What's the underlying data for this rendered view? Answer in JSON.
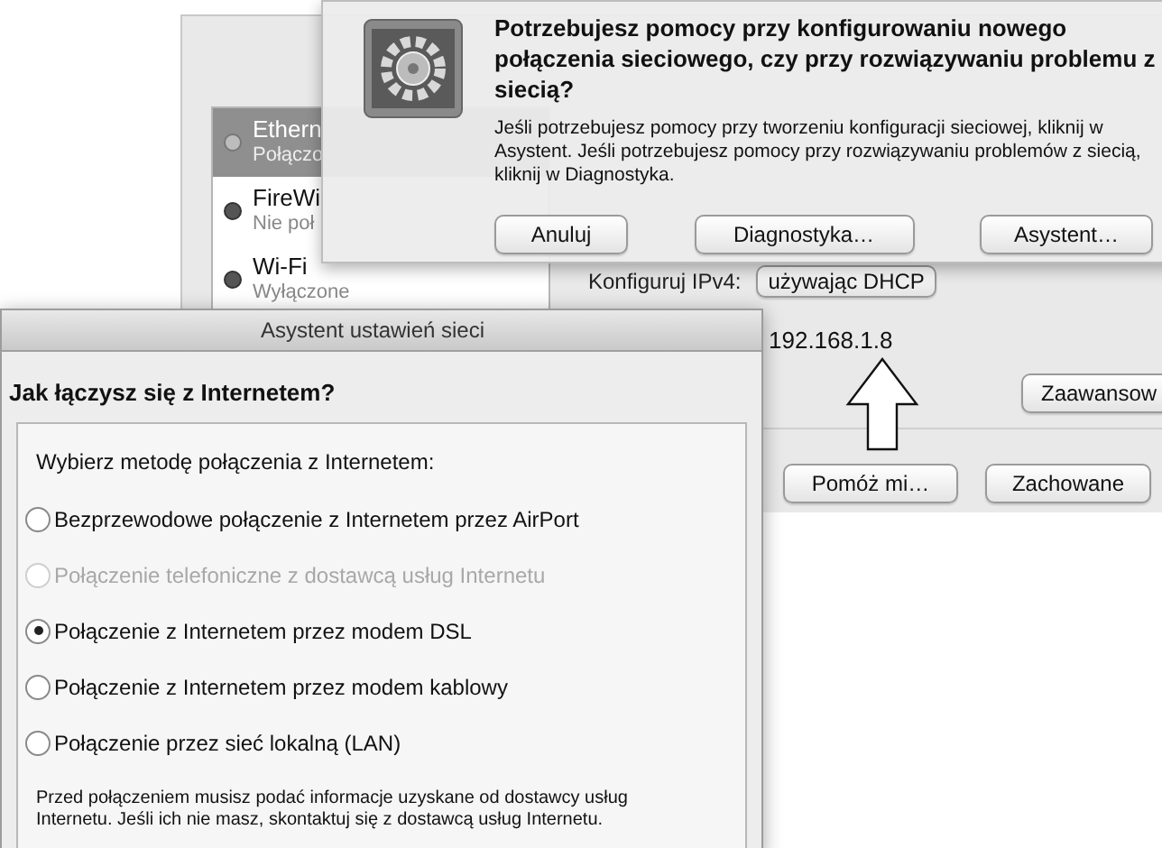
{
  "network_window": {
    "sidebar": [
      {
        "name": "Ethern",
        "status": "Połączo",
        "selected": true
      },
      {
        "name": "FireWi",
        "status": "Nie poł",
        "selected": false
      },
      {
        "name": "Wi-Fi",
        "status": "Wyłączone",
        "selected": false
      }
    ],
    "configure_label": "Konfiguruj IPv4:",
    "configure_value": "używając DHCP",
    "ip_address": "192.168.1.8",
    "advanced_button": "Zaawansow",
    "help_button": "Pomóż mi…",
    "saved_button": "Zachowane"
  },
  "sheet": {
    "title": "Potrzebujesz pomocy przy konfigurowaniu nowego połączenia sieciowego, czy przy rozwiązywaniu problemu z siecią?",
    "message": "Jeśli potrzebujesz pomocy przy tworzeniu konfiguracji sieciowej, kliknij w Asystent. Jeśli potrzebujesz pomocy przy rozwiązywaniu problemów z siecią, kliknij w Diagnostyka.",
    "buttons": [
      {
        "label": "Anuluj"
      },
      {
        "label": "Diagnostyka…"
      },
      {
        "label": "Asystent…"
      }
    ]
  },
  "assistant": {
    "title": "Asystent ustawień sieci",
    "heading": "Jak łączysz się z Internetem?",
    "prompt": "Wybierz metodę połączenia z Internetem:",
    "options": [
      {
        "label": "Bezprzewodowe połączenie z Internetem przez AirPort",
        "selected": false,
        "disabled": false
      },
      {
        "label": "Połączenie telefoniczne z dostawcą usług Internetu",
        "selected": false,
        "disabled": true
      },
      {
        "label": "Połączenie z Internetem przez modem DSL",
        "selected": true,
        "disabled": false
      },
      {
        "label": "Połączenie z Internetem przez modem kablowy",
        "selected": false,
        "disabled": false
      },
      {
        "label": "Połączenie przez sieć lokalną (LAN)",
        "selected": false,
        "disabled": false
      }
    ],
    "note": "Przed połączeniem musisz podać informacje uzyskane od dostawcy usług Internetu. Jeśli ich nie masz, skontaktuj się z dostawcą usług Internetu."
  }
}
